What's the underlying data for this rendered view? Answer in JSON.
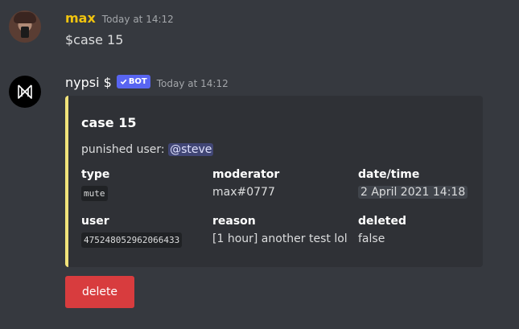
{
  "messages": [
    {
      "author": "max",
      "timestamp": "Today at 14:12",
      "content": "$case 15"
    },
    {
      "author": "nypsi $",
      "bot_badge": "BOT",
      "timestamp": "Today at 14:12",
      "embed": {
        "title": "case 15",
        "description_prefix": "punished user:",
        "mention": "@steve",
        "accent_color": "#f1e37a",
        "fields": {
          "type": {
            "name": "type",
            "value": "mute"
          },
          "moderator": {
            "name": "moderator",
            "value": "max#0777"
          },
          "datetime": {
            "name": "date/time",
            "value": "2 April 2021 14:18"
          },
          "user": {
            "name": "user",
            "value": "475248052962066433"
          },
          "reason": {
            "name": "reason",
            "value": "[1 hour] another test lol"
          },
          "deleted": {
            "name": "deleted",
            "value": "false"
          }
        }
      },
      "button": {
        "label": "delete",
        "color": "#d83c3e"
      }
    }
  ]
}
